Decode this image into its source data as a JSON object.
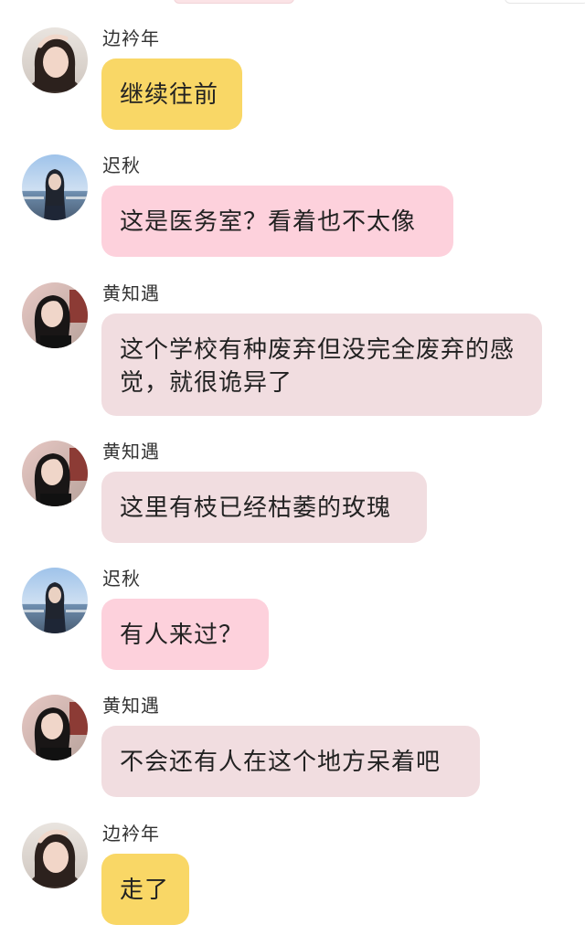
{
  "colors": {
    "bubble_bian": "#f9d766",
    "bubble_chi": "#fdd1dc",
    "bubble_huang": "#f1dde0"
  },
  "messages": [
    {
      "sender": "边衿年",
      "text": "继续往前"
    },
    {
      "sender": "迟秋",
      "text": "这是医务室？看着也不太像"
    },
    {
      "sender": "黄知遇",
      "text": "这个学校有种废弃但没完全废弃的感觉，就很诡异了"
    },
    {
      "sender": "黄知遇",
      "text": "这里有枝已经枯萎的玫瑰"
    },
    {
      "sender": "迟秋",
      "text": "有人来过？"
    },
    {
      "sender": "黄知遇",
      "text": "不会还有人在这个地方呆着吧"
    },
    {
      "sender": "边衿年",
      "text": "走了"
    }
  ]
}
